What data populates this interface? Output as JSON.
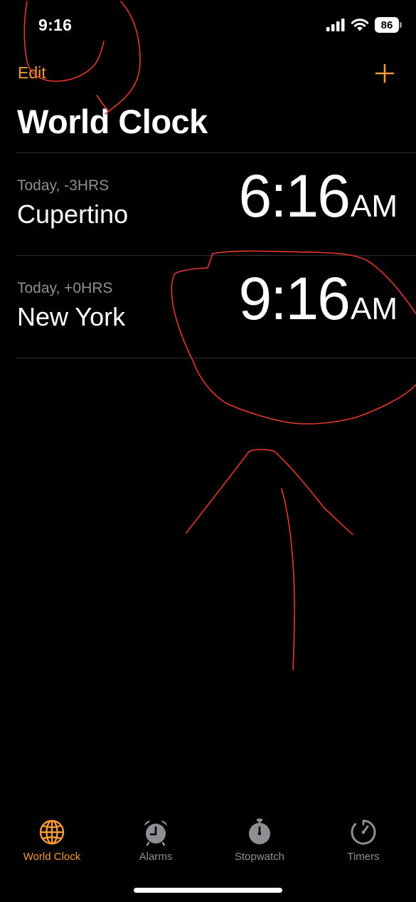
{
  "status_bar": {
    "time": "9:16",
    "battery": "86"
  },
  "nav": {
    "edit_label": "Edit",
    "add_icon": "plus-icon"
  },
  "title": "World Clock",
  "clocks": [
    {
      "offset": "Today, -3HRS",
      "city": "Cupertino",
      "time": "6:16",
      "ampm": "AM"
    },
    {
      "offset": "Today, +0HRS",
      "city": "New York",
      "time": "9:16",
      "ampm": "AM"
    }
  ],
  "tabs": [
    {
      "label": "World Clock",
      "icon": "globe-icon",
      "active": true
    },
    {
      "label": "Alarms",
      "icon": "alarm-clock-icon",
      "active": false
    },
    {
      "label": "Stopwatch",
      "icon": "stopwatch-icon",
      "active": false
    },
    {
      "label": "Timers",
      "icon": "timer-icon",
      "active": false
    }
  ],
  "colors": {
    "accent": "#f59a35",
    "background": "#000000",
    "secondary_text": "#8e8e93",
    "annotation": "#e8372e"
  }
}
